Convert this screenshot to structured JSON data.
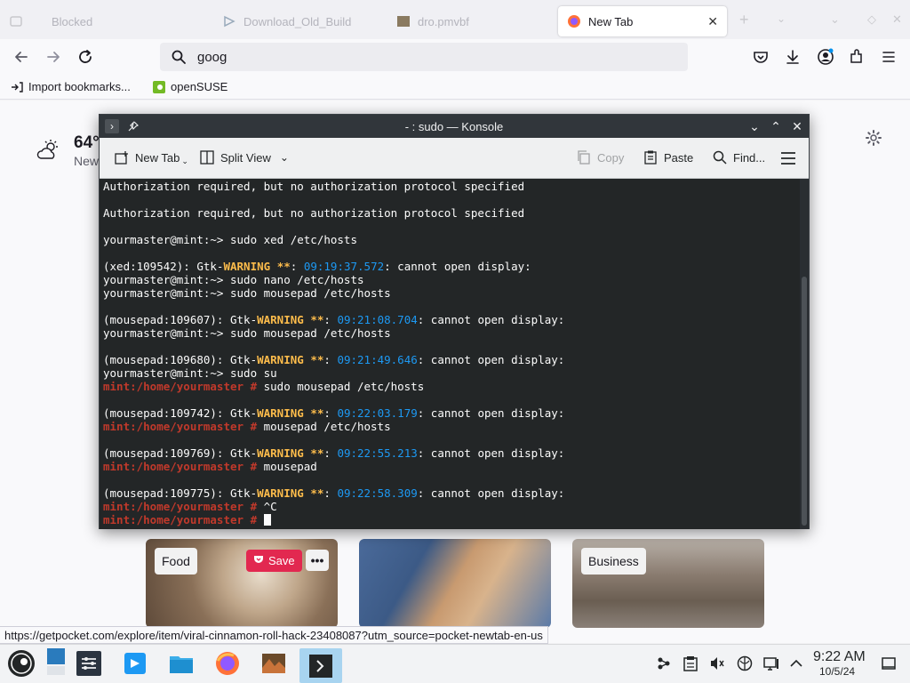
{
  "browser": {
    "tabs": [
      {
        "label": "Blocked",
        "active": false
      },
      {
        "label": "Download_Old_Build",
        "active": false
      },
      {
        "label": "dro.pmvbf",
        "active": false
      },
      {
        "label": "New Tab",
        "active": true
      }
    ],
    "url_value": "goog",
    "bookmarks": [
      {
        "label": "Import bookmarks...",
        "icon": "import-icon"
      },
      {
        "label": "openSUSE",
        "icon": "opensuse-icon"
      }
    ],
    "status_url": "https://getpocket.com/explore/item/viral-cinnamon-roll-hack-23408087?utm_source=pocket-newtab-en-us"
  },
  "newtab": {
    "weather_temp": "64°",
    "weather_sub": "New",
    "cards": [
      {
        "tag": "Food"
      },
      {
        "tag": ""
      },
      {
        "tag": "Business"
      }
    ],
    "save_label": "Save",
    "more_label": "•••"
  },
  "konsole": {
    "title": "- : sudo — Konsole",
    "toolbar": {
      "new_tab": "New Tab",
      "split_view": "Split View",
      "copy": "Copy",
      "paste": "Paste",
      "find": "Find..."
    },
    "lines": [
      "Authorization required, but no authorization protocol specified",
      "",
      "Authorization required, but no authorization protocol specified",
      "",
      "yourmaster@mint:~> sudo xed /etc/hosts",
      "",
      "(xed:109542): Gtk-WARNING **: 09:19:37.572: cannot open display:",
      "yourmaster@mint:~> sudo nano /etc/hosts",
      "yourmaster@mint:~> sudo mousepad /etc/hosts",
      "",
      "(mousepad:109607): Gtk-WARNING **: 09:21:08.704: cannot open display:",
      "yourmaster@mint:~> sudo mousepad /etc/hosts",
      "",
      "(mousepad:109680): Gtk-WARNING **: 09:21:49.646: cannot open display:",
      "yourmaster@mint:~> sudo su",
      "mint:/home/yourmaster # sudo mousepad /etc/hosts",
      "",
      "(mousepad:109742): Gtk-WARNING **: 09:22:03.179: cannot open display:",
      "mint:/home/yourmaster # mousepad /etc/hosts",
      "",
      "(mousepad:109769): Gtk-WARNING **: 09:22:55.213: cannot open display:",
      "mint:/home/yourmaster # mousepad",
      "",
      "(mousepad:109775): Gtk-WARNING **: 09:22:58.309: cannot open display:",
      "mint:/home/yourmaster # ^C",
      "mint:/home/yourmaster # "
    ],
    "root_prompt": "mint:/home/yourmaster #",
    "colors": {
      "warning": "#fdbc4b",
      "time": "#1d99f3",
      "root_prompt": "#c0392b",
      "background": "#232627"
    }
  },
  "taskbar": {
    "clock_time": "9:22 AM",
    "clock_date": "10/5/24"
  }
}
